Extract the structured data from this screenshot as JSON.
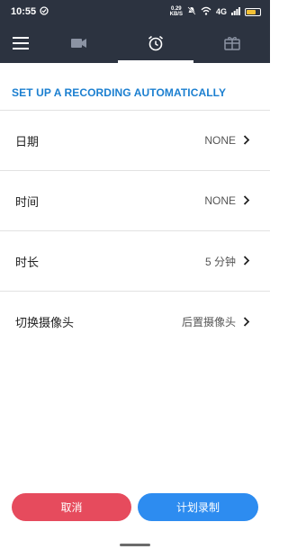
{
  "status_bar": {
    "time": "10:55",
    "net_speed_value": "0.29",
    "net_speed_unit": "KB/S",
    "signal_label": "4G",
    "battery_level": 0.7
  },
  "toolbar": {
    "tabs": [
      {
        "icon": "hamburger-menu-icon"
      },
      {
        "icon": "video-camera-icon"
      },
      {
        "icon": "alarm-clock-icon",
        "active": true
      },
      {
        "icon": "gift-icon"
      }
    ]
  },
  "section": {
    "heading": "SET UP A RECORDING AUTOMATICALLY"
  },
  "rows": [
    {
      "label": "日期",
      "value": "NONE"
    },
    {
      "label": "时间",
      "value": "NONE"
    },
    {
      "label": "时长",
      "value": "5 分钟"
    },
    {
      "label": "切换摄像头",
      "value": "后置摄像头"
    }
  ],
  "buttons": {
    "cancel": "取消",
    "schedule": "计划录制"
  },
  "colors": {
    "toolbar_bg": "#2c3340",
    "heading": "#1b7fd0",
    "cancel": "#e64b5d",
    "schedule": "#2d8cf0"
  }
}
